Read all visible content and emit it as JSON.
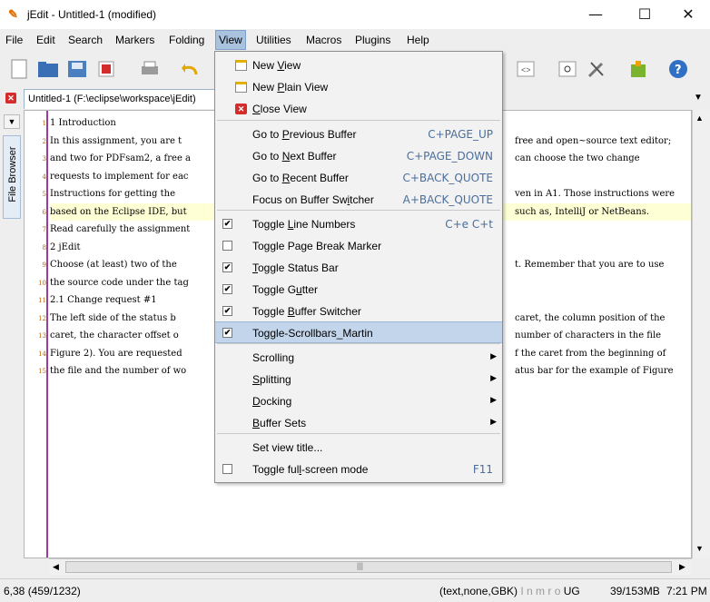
{
  "window": {
    "title": "jEdit - Untitled-1 (modified)",
    "minimize": "—",
    "maximize": "☐",
    "close": "✕"
  },
  "menubar": [
    "File",
    "Edit",
    "Search",
    "Markers",
    "Folding",
    "View",
    "Utilities",
    "Macros",
    "Plugins",
    "Help"
  ],
  "tab": {
    "label": "Untitled-1 (F:\\eclipse\\workspace\\jEdit)"
  },
  "dock": {
    "file_browser": "File Browser"
  },
  "editor": {
    "lines": [
      {
        "n": "1",
        "t": "1 Introduction",
        "r": ""
      },
      {
        "n": "2",
        "t": "In this assignment, you are t",
        "r": "free and open~source text editor;"
      },
      {
        "n": "3",
        "t": "and two for PDFsam2, a free a",
        "r": "can choose the two change"
      },
      {
        "n": "4",
        "t": "requests to implement for eac",
        "r": ""
      },
      {
        "n": "5",
        "t": "Instructions for getting the",
        "r": "ven in A1. Those instructions were"
      },
      {
        "n": "6",
        "t": "based on the Eclipse IDE, but",
        "r": "such as, IntelliJ or NetBeans."
      },
      {
        "n": "7",
        "t": "Read carefully the assignment",
        "r": ""
      },
      {
        "n": "8",
        "t": "2 jEdit",
        "r": ""
      },
      {
        "n": "9",
        "t": "Choose (at least) two of the",
        "r": "t. Remember that you are to use"
      },
      {
        "n": "10",
        "t": "the source code under the tag",
        "r": ""
      },
      {
        "n": "11",
        "t": "2.1 Change request #1",
        "r": ""
      },
      {
        "n": "12",
        "t": "The left side of the status b",
        "r": "caret, the column position of the"
      },
      {
        "n": "13",
        "t": "caret, the character offset o",
        "r": "number of characters in the file"
      },
      {
        "n": "14",
        "t": "Figure 2). You are requested",
        "r": "f the caret from the beginning of"
      },
      {
        "n": "15",
        "t": "the file and the number of wo",
        "r": "atus bar for the example of Figure"
      }
    ]
  },
  "view_menu": {
    "items": [
      {
        "label": "New View",
        "accel": "",
        "icon": "new-view-icon"
      },
      {
        "label": "New Plain View",
        "accel": "",
        "icon": "new-plain-view-icon"
      },
      {
        "label": "Close View",
        "accel": "",
        "icon": "close-view-icon"
      },
      {
        "label": "Go to Previous Buffer",
        "accel": "C+PAGE_UP"
      },
      {
        "label": "Go to Next Buffer",
        "accel": "C+PAGE_DOWN"
      },
      {
        "label": "Go to Recent Buffer",
        "accel": "C+BACK_QUOTE"
      },
      {
        "label": "Focus on Buffer Switcher",
        "accel": "A+BACK_QUOTE"
      },
      {
        "label": "Toggle Line Numbers",
        "accel": "C+e C+t",
        "checked": true
      },
      {
        "label": "Toggle Page Break Marker",
        "accel": "",
        "checked": false
      },
      {
        "label": "Toggle Status Bar",
        "accel": "",
        "checked": true
      },
      {
        "label": "Toggle Gutter",
        "accel": "",
        "checked": true
      },
      {
        "label": "Toggle Buffer Switcher",
        "accel": "",
        "checked": true
      },
      {
        "label": "Toggle-Scrollbars_Martin",
        "accel": "",
        "checked": true
      },
      {
        "label": "Scrolling",
        "submenu": true
      },
      {
        "label": "Splitting",
        "submenu": true
      },
      {
        "label": "Docking",
        "submenu": true
      },
      {
        "label": "Buffer Sets",
        "submenu": true
      },
      {
        "label": "Set view title...",
        "accel": ""
      },
      {
        "label": "Toggle full-screen mode",
        "accel": "F11",
        "checked": false
      }
    ]
  },
  "statusbar": {
    "position": "6,38 (459/1232)",
    "mode": "(text,none,GBK)",
    "flags": " I n m r o ",
    "encoding_flag": "UG",
    "memory": "39/153MB",
    "time": "7:21 PM"
  },
  "colors": {
    "menu_selected": "#c2d5ea",
    "accelerator": "#4a6e9c",
    "gutter_border": "#9a3b9e",
    "line_numbers": "#c06000"
  }
}
